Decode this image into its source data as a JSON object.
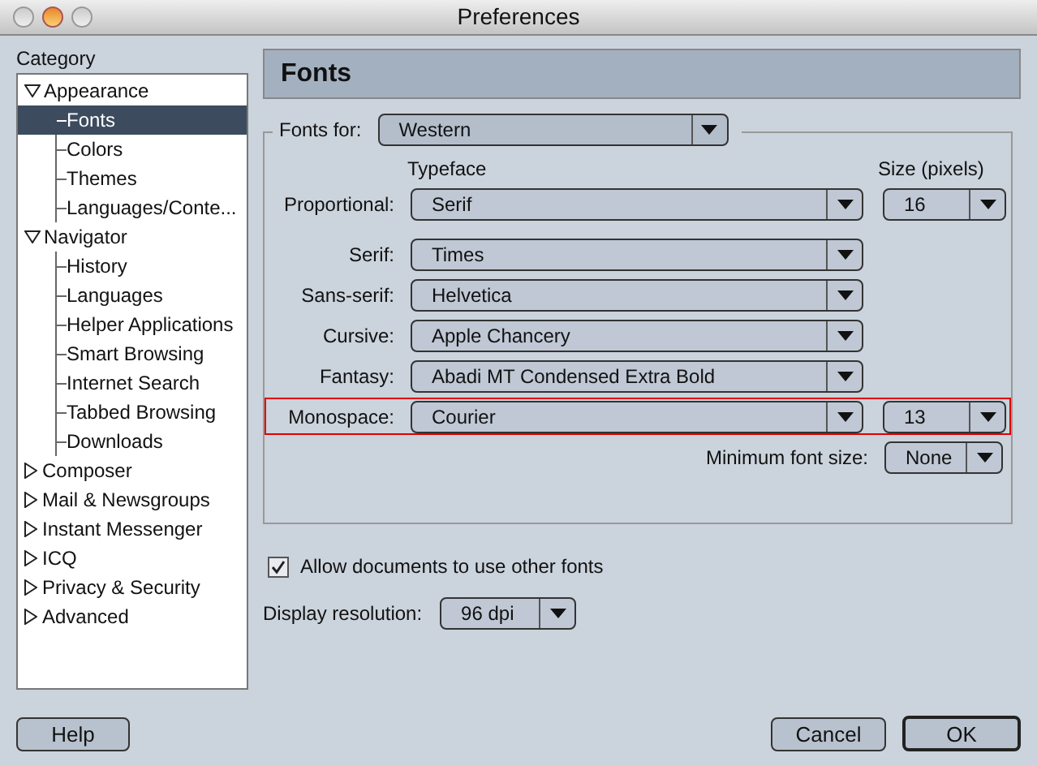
{
  "window": {
    "title": "Preferences"
  },
  "sidebar": {
    "heading": "Category",
    "items": [
      {
        "label": "Appearance",
        "expanded": true,
        "selected": false,
        "children": [
          {
            "label": "Fonts",
            "selected": true
          },
          {
            "label": "Colors",
            "selected": false
          },
          {
            "label": "Themes",
            "selected": false
          },
          {
            "label": "Languages/Conte...",
            "selected": false
          }
        ]
      },
      {
        "label": "Navigator",
        "expanded": true,
        "selected": false,
        "children": [
          {
            "label": "History",
            "selected": false
          },
          {
            "label": "Languages",
            "selected": false
          },
          {
            "label": "Helper Applications",
            "selected": false
          },
          {
            "label": "Smart Browsing",
            "selected": false
          },
          {
            "label": "Internet Search",
            "selected": false
          },
          {
            "label": "Tabbed Browsing",
            "selected": false
          },
          {
            "label": "Downloads",
            "selected": false
          }
        ]
      },
      {
        "label": "Composer",
        "expanded": false,
        "selected": false
      },
      {
        "label": "Mail & Newsgroups",
        "expanded": false,
        "selected": false
      },
      {
        "label": "Instant Messenger",
        "expanded": false,
        "selected": false
      },
      {
        "label": "ICQ",
        "expanded": false,
        "selected": false
      },
      {
        "label": "Privacy & Security",
        "expanded": false,
        "selected": false
      },
      {
        "label": "Advanced",
        "expanded": false,
        "selected": false
      }
    ]
  },
  "panel": {
    "title": "Fonts",
    "fonts_for": {
      "label": "Fonts for:",
      "value": "Western"
    },
    "typeface_heading": "Typeface",
    "size_heading": "Size (pixels)",
    "rows": [
      {
        "label": "Proportional:",
        "typeface": "Serif",
        "size": "16",
        "highlighted": false
      },
      {
        "label": "Serif:",
        "typeface": "Times",
        "highlighted": false
      },
      {
        "label": "Sans-serif:",
        "typeface": "Helvetica",
        "highlighted": false
      },
      {
        "label": "Cursive:",
        "typeface": "Apple Chancery",
        "highlighted": false
      },
      {
        "label": "Fantasy:",
        "typeface": "Abadi MT Condensed Extra Bold",
        "highlighted": false
      },
      {
        "label": "Monospace:",
        "typeface": "Courier",
        "size": "13",
        "highlighted": true
      }
    ],
    "minimum_font_size": {
      "label": "Minimum font size:",
      "value": "None"
    },
    "allow_documents": {
      "label": "Allow documents to use other fonts",
      "checked": true
    },
    "display_resolution": {
      "label": "Display resolution:",
      "value": "96 dpi"
    }
  },
  "buttons": {
    "help": "Help",
    "cancel": "Cancel",
    "ok": "OK"
  }
}
